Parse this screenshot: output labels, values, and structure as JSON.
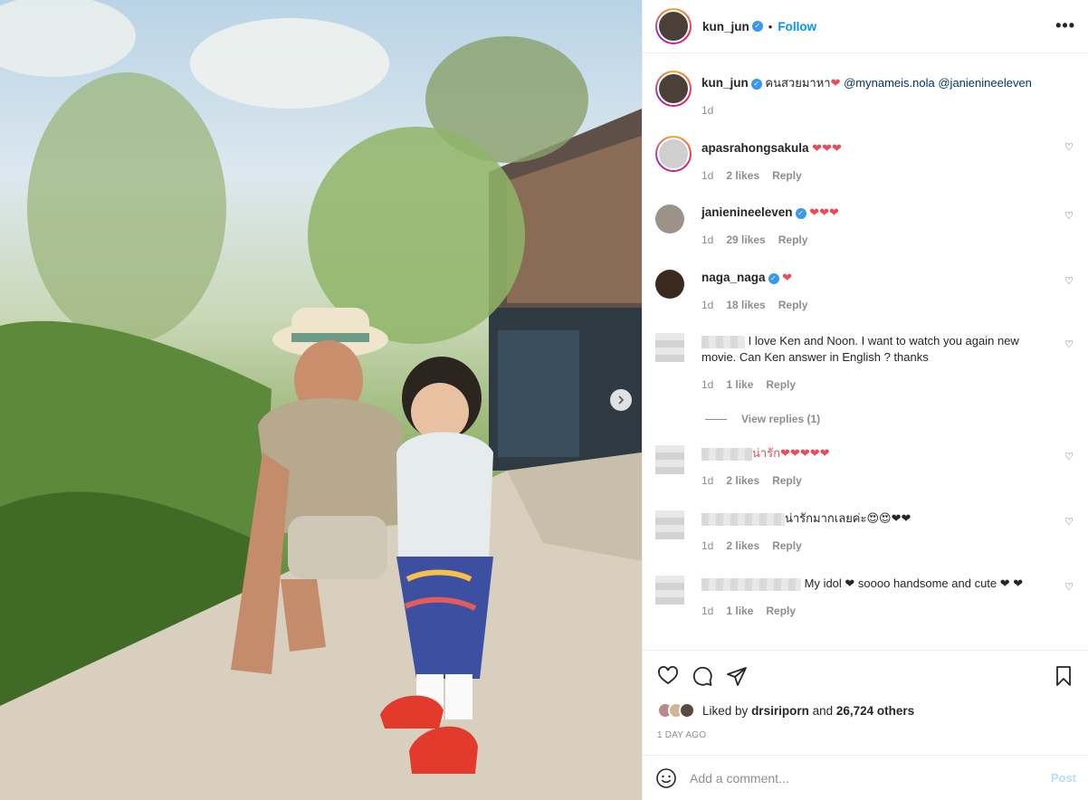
{
  "post": {
    "author": "kun_jun",
    "follow_label": "Follow",
    "dot": "•",
    "more_label": "•••",
    "caption_text": "คนสวยมาหา",
    "caption_heart": "❤",
    "caption_mentions": [
      "@mynameis.nola",
      "@janienineeleven"
    ],
    "caption_time": "1d"
  },
  "comments": [
    {
      "user": "apasrahongsakula",
      "verified": false,
      "text": "❤❤❤",
      "time": "1d",
      "likes": "2 likes",
      "reply": "Reply"
    },
    {
      "user": "janienineeleven",
      "verified": true,
      "text": "❤❤❤",
      "time": "1d",
      "likes": "29 likes",
      "reply": "Reply"
    },
    {
      "user": "naga_naga",
      "verified": true,
      "text": "❤",
      "time": "1d",
      "likes": "18 likes",
      "reply": "Reply"
    },
    {
      "user": "",
      "verified": false,
      "text": "I love Ken and Noon. I want to watch you again new movie. Can Ken answer in English ? thanks",
      "time": "1d",
      "likes": "1 like",
      "reply": "Reply"
    },
    {
      "user": "",
      "verified": false,
      "text": "น่ารัก❤❤❤❤❤",
      "time": "1d",
      "likes": "2 likes",
      "reply": "Reply"
    },
    {
      "user": "",
      "verified": false,
      "text": "น่ารักมากเลยค่ะ😍😍❤❤",
      "time": "1d",
      "likes": "2 likes",
      "reply": "Reply"
    },
    {
      "user": "",
      "verified": false,
      "text": "My idol ❤ soooo handsome and cute ❤ ❤",
      "time": "1d",
      "likes": "1 like",
      "reply": "Reply"
    }
  ],
  "view_replies": "View replies (1)",
  "actions": {
    "liked_prefix": "Liked by",
    "liked_user": "drsiriporn",
    "liked_and": "and",
    "liked_count": "26,724 others",
    "date": "1 DAY AGO"
  },
  "add_comment": {
    "placeholder": "Add a comment...",
    "post_label": "Post"
  },
  "icons": {
    "like": "heart-outline-icon",
    "comment": "comment-bubble-icon",
    "share": "paper-plane-icon",
    "save": "bookmark-icon",
    "emoji": "smiley-icon",
    "next": "chevron-right-icon"
  },
  "colors": {
    "accent": "#0095f6",
    "heart": "#ed4956",
    "verified": "#3897f0"
  }
}
